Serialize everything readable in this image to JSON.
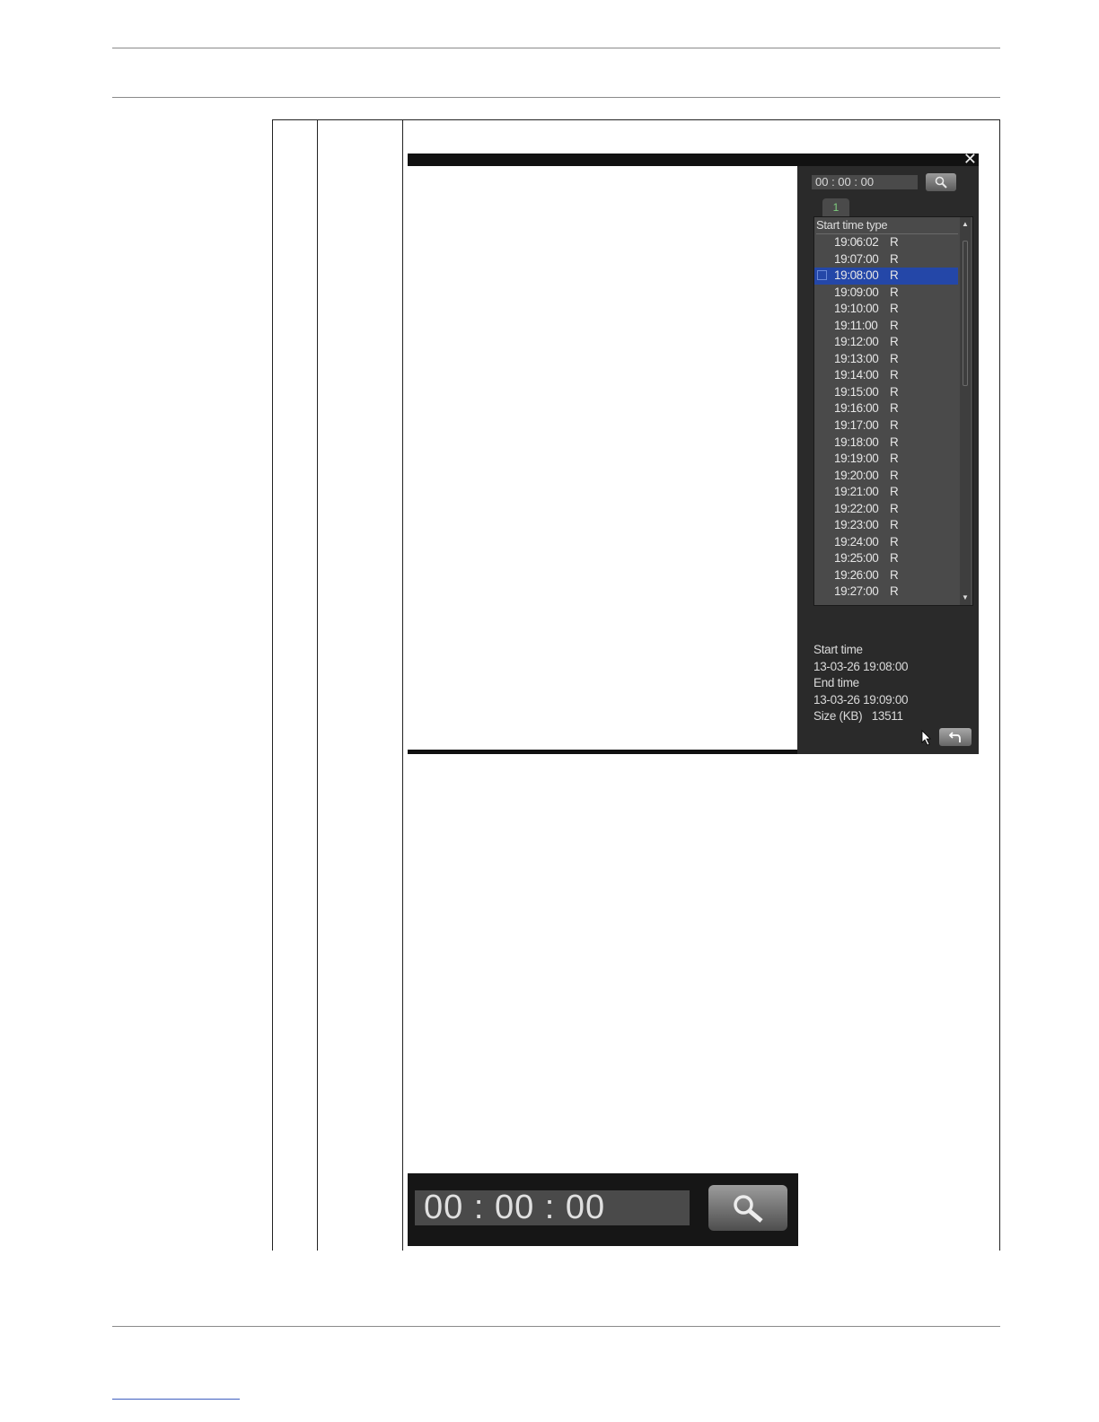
{
  "dialog": {
    "close_label": "✕",
    "search": {
      "time_value": "00 : 00 : 00"
    },
    "tab_label": "1",
    "list": {
      "header": "Start time type",
      "rows": [
        {
          "time": "19:06:02",
          "type": "R"
        },
        {
          "time": "19:07:00",
          "type": "R"
        },
        {
          "time": "19:08:00",
          "type": "R",
          "selected": true
        },
        {
          "time": "19:09:00",
          "type": "R"
        },
        {
          "time": "19:10:00",
          "type": "R"
        },
        {
          "time": "19:11:00",
          "type": "R"
        },
        {
          "time": "19:12:00",
          "type": "R"
        },
        {
          "time": "19:13:00",
          "type": "R"
        },
        {
          "time": "19:14:00",
          "type": "R"
        },
        {
          "time": "19:15:00",
          "type": "R"
        },
        {
          "time": "19:16:00",
          "type": "R"
        },
        {
          "time": "19:17:00",
          "type": "R"
        },
        {
          "time": "19:18:00",
          "type": "R"
        },
        {
          "time": "19:19:00",
          "type": "R"
        },
        {
          "time": "19:20:00",
          "type": "R"
        },
        {
          "time": "19:21:00",
          "type": "R"
        },
        {
          "time": "19:22:00",
          "type": "R"
        },
        {
          "time": "19:23:00",
          "type": "R"
        },
        {
          "time": "19:24:00",
          "type": "R"
        },
        {
          "time": "19:25:00",
          "type": "R"
        },
        {
          "time": "19:26:00",
          "type": "R"
        },
        {
          "time": "19:27:00",
          "type": "R"
        }
      ]
    },
    "details": {
      "start_label": "Start time",
      "start_value": "13-03-26  19:08:00",
      "end_label": "End time",
      "end_value": "13-03-26  19:09:00",
      "size_label": "Size (KB)",
      "size_value": "13511"
    }
  },
  "zoom_search": {
    "time_value": "00 : 00 : 00"
  },
  "colors": {
    "selected_row": "#2447a8",
    "tab_text": "#7fd07f",
    "panel_bg": "#2a2a2a",
    "list_bg": "#4a4a4a"
  }
}
